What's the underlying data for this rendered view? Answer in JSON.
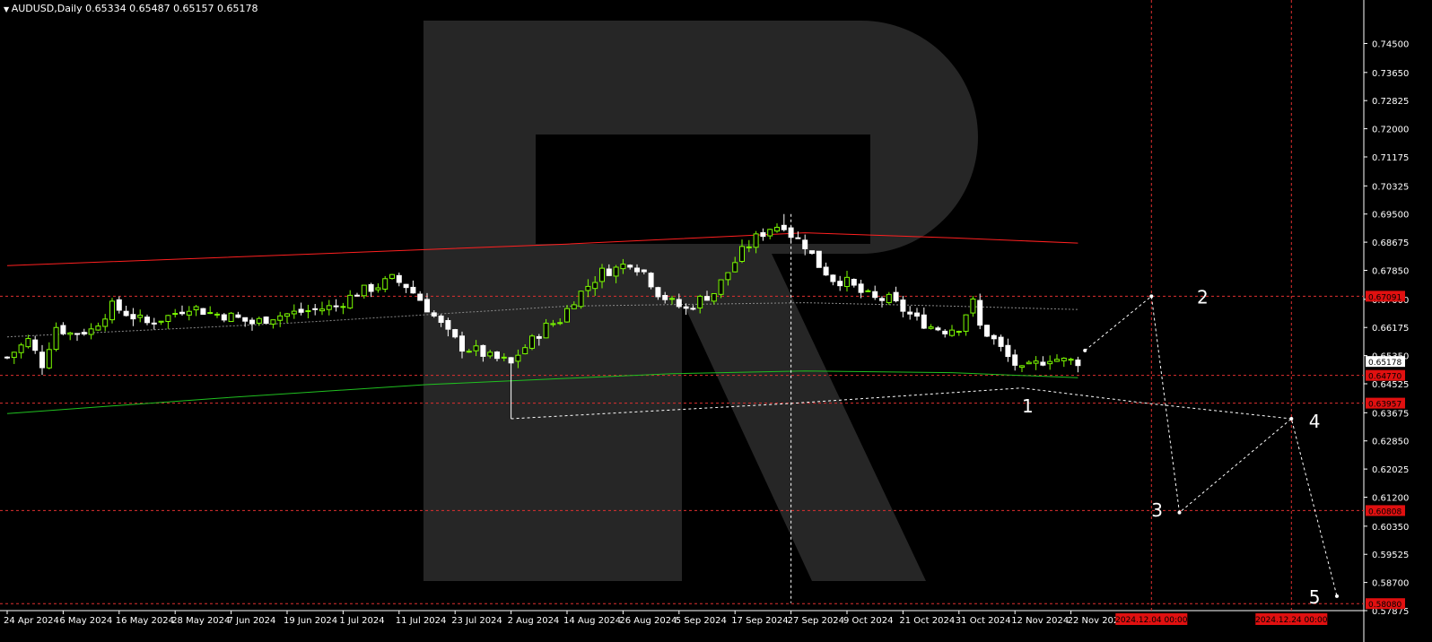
{
  "header": {
    "symbol": "AUDUSD,Daily",
    "ohlc": "0.65334 0.65487 0.65157 0.65178"
  },
  "colors": {
    "background": "#000000",
    "bull": "#7CFC00",
    "bear": "#FFFFFF",
    "ma_red": "#FF2020",
    "ma_green": "#20C020",
    "level": "#E03030",
    "badge": "#E01010"
  },
  "chart_data": {
    "type": "candlestick",
    "title": "",
    "ylim": [
      0.57875,
      0.7538
    ],
    "yticks": [
      "0.74500",
      "0.73650",
      "0.72825",
      "0.72000",
      "0.71175",
      "0.70325",
      "0.69500",
      "0.68675",
      "0.67850",
      "0.67000",
      "0.66175",
      "0.65350",
      "0.64525",
      "0.63675",
      "0.62850",
      "0.62025",
      "0.61200",
      "0.60350",
      "0.59525",
      "0.58700",
      "0.57875"
    ],
    "xticks": [
      {
        "label": "24 Apr 2024",
        "i": 0
      },
      {
        "label": "6 May 2024",
        "i": 8
      },
      {
        "label": "16 May 2024",
        "i": 16
      },
      {
        "label": "28 May 2024",
        "i": 24
      },
      {
        "label": "7 Jun 2024",
        "i": 32
      },
      {
        "label": "19 Jun 2024",
        "i": 40
      },
      {
        "label": "1 Jul 2024",
        "i": 48
      },
      {
        "label": "11 Jul 2024",
        "i": 56
      },
      {
        "label": "23 Jul 2024",
        "i": 64
      },
      {
        "label": "2 Aug 2024",
        "i": 72
      },
      {
        "label": "14 Aug 2024",
        "i": 80
      },
      {
        "label": "26 Aug 2024",
        "i": 88
      },
      {
        "label": "5 Sep 2024",
        "i": 96
      },
      {
        "label": "17 Sep 2024",
        "i": 104
      },
      {
        "label": "27 Sep 2024",
        "i": 112
      },
      {
        "label": "9 Oct 2024",
        "i": 120
      },
      {
        "label": "21 Oct 2024",
        "i": 128
      },
      {
        "label": "31 Oct 2024",
        "i": 136
      },
      {
        "label": "12 Nov 2024",
        "i": 144
      },
      {
        "label": "22 Nov 2024",
        "i": 152
      }
    ],
    "close_path": [
      [
        0,
        0.653
      ],
      [
        3,
        0.658
      ],
      [
        5,
        0.651
      ],
      [
        7,
        0.662
      ],
      [
        9,
        0.66
      ],
      [
        12,
        0.661
      ],
      [
        15,
        0.668
      ],
      [
        18,
        0.665
      ],
      [
        20,
        0.663
      ],
      [
        23,
        0.665
      ],
      [
        26,
        0.668
      ],
      [
        29,
        0.666
      ],
      [
        32,
        0.665
      ],
      [
        35,
        0.663
      ],
      [
        38,
        0.665
      ],
      [
        41,
        0.666
      ],
      [
        44,
        0.667
      ],
      [
        47,
        0.668
      ],
      [
        50,
        0.672
      ],
      [
        53,
        0.674
      ],
      [
        55,
        0.676
      ],
      [
        57,
        0.674
      ],
      [
        59,
        0.67
      ],
      [
        61,
        0.665
      ],
      [
        63,
        0.66
      ],
      [
        65,
        0.656
      ],
      [
        67,
        0.655
      ],
      [
        69,
        0.653
      ],
      [
        71,
        0.652
      ],
      [
        72,
        0.651
      ],
      [
        73,
        0.654
      ],
      [
        75,
        0.658
      ],
      [
        77,
        0.662
      ],
      [
        79,
        0.664
      ],
      [
        81,
        0.67
      ],
      [
        83,
        0.674
      ],
      [
        85,
        0.678
      ],
      [
        87,
        0.679
      ],
      [
        89,
        0.681
      ],
      [
        91,
        0.678
      ],
      [
        93,
        0.672
      ],
      [
        95,
        0.669
      ],
      [
        97,
        0.667
      ],
      [
        99,
        0.67
      ],
      [
        101,
        0.672
      ],
      [
        103,
        0.678
      ],
      [
        105,
        0.684
      ],
      [
        107,
        0.688
      ],
      [
        109,
        0.691
      ],
      [
        111,
        0.692
      ],
      [
        112,
        0.689
      ],
      [
        114,
        0.686
      ],
      [
        116,
        0.68
      ],
      [
        118,
        0.676
      ],
      [
        120,
        0.675
      ],
      [
        122,
        0.672
      ],
      [
        124,
        0.67
      ],
      [
        126,
        0.67
      ],
      [
        128,
        0.667
      ],
      [
        130,
        0.664
      ],
      [
        132,
        0.662
      ],
      [
        134,
        0.661
      ],
      [
        136,
        0.662
      ],
      [
        137,
        0.666
      ],
      [
        138,
        0.669
      ],
      [
        139,
        0.662
      ],
      [
        141,
        0.658
      ],
      [
        143,
        0.653
      ],
      [
        144,
        0.651
      ],
      [
        145,
        0.649
      ],
      [
        147,
        0.651
      ],
      [
        149,
        0.653
      ],
      [
        151,
        0.652
      ],
      [
        153,
        0.6518
      ]
    ],
    "candle_count": 154,
    "series": [
      {
        "kind": "ma",
        "color": "red",
        "points": [
          [
            0,
            0.6799
          ],
          [
            40,
            0.683
          ],
          [
            80,
            0.6862
          ],
          [
            114,
            0.6895
          ],
          [
            135,
            0.688
          ],
          [
            153,
            0.6865
          ]
        ]
      },
      {
        "kind": "ma",
        "color": "green",
        "points": [
          [
            0,
            0.6365
          ],
          [
            30,
            0.641
          ],
          [
            60,
            0.645
          ],
          [
            95,
            0.6482
          ],
          [
            114,
            0.649
          ],
          [
            135,
            0.6485
          ],
          [
            153,
            0.647
          ]
        ]
      },
      {
        "kind": "ma",
        "color": "gray-dashed",
        "points": [
          [
            0,
            0.659
          ],
          [
            40,
            0.663
          ],
          [
            80,
            0.668
          ],
          [
            114,
            0.669
          ],
          [
            135,
            0.668
          ],
          [
            153,
            0.667
          ]
        ]
      }
    ],
    "levels": [
      {
        "label": "0.67091",
        "value": 0.67091,
        "badge": true
      },
      {
        "label": "0.64770",
        "value": 0.6477,
        "badge": true
      },
      {
        "label": "0.63957",
        "value": 0.63957,
        "badge": true
      },
      {
        "label": "0.60808",
        "value": 0.60808,
        "badge": true
      },
      {
        "label": "0.58080",
        "value": 0.5808,
        "badge": true
      }
    ],
    "current_price": {
      "label": "0.65178",
      "value": 0.65178
    },
    "vlines": [
      {
        "label": "2024.12.04 00:00",
        "i": 163.5
      },
      {
        "label": "2024.12.24 00:00",
        "i": 183.5
      }
    ],
    "forecast": [
      [
        154,
        0.655
      ],
      [
        163.5,
        0.6709
      ],
      [
        167.5,
        0.6075
      ],
      [
        183.5,
        0.635
      ],
      [
        190,
        0.583
      ]
    ],
    "wave_labels": [
      {
        "text": "1",
        "i": 145,
        "y": 0.639
      },
      {
        "text": "2",
        "i": 170,
        "y": 0.6709
      },
      {
        "text": "3",
        "i": 163.5,
        "y": 0.6085
      },
      {
        "text": "4",
        "i": 186,
        "y": 0.6345
      },
      {
        "text": "5",
        "i": 186,
        "y": 0.583
      }
    ],
    "triangle": [
      [
        72,
        0.635
      ],
      [
        112,
        0.6395
      ],
      [
        145,
        0.644
      ],
      [
        163,
        0.6395
      ],
      [
        183.5,
        0.635
      ]
    ],
    "vertical_marker": {
      "i": 112,
      "top": 0.695,
      "bottom": 0.581
    }
  }
}
